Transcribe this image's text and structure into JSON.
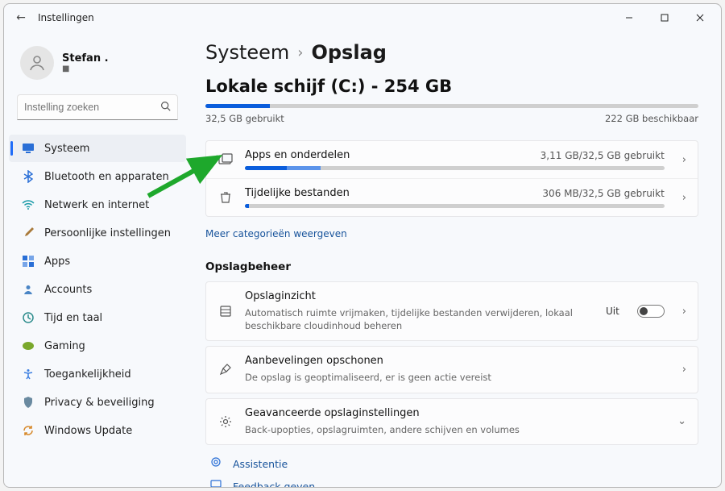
{
  "window": {
    "title": "Instellingen"
  },
  "user": {
    "name": "Stefan .",
    "sub": "■"
  },
  "search": {
    "placeholder": "Instelling zoeken"
  },
  "sidebar": {
    "items": [
      {
        "label": "Systeem",
        "active": true
      },
      {
        "label": "Bluetooth en apparaten"
      },
      {
        "label": "Netwerk en internet"
      },
      {
        "label": "Persoonlijke instellingen"
      },
      {
        "label": "Apps"
      },
      {
        "label": "Accounts"
      },
      {
        "label": "Tijd en taal"
      },
      {
        "label": "Gaming"
      },
      {
        "label": "Toegankelijkheid"
      },
      {
        "label": "Privacy & beveiliging"
      },
      {
        "label": "Windows Update"
      }
    ]
  },
  "breadcrumb": {
    "root": "Systeem",
    "current": "Opslag"
  },
  "drive": {
    "title": "Lokale schijf (C:) - 254 GB",
    "used": "32,5 GB gebruikt",
    "free": "222 GB beschikbaar",
    "used_pct": 13
  },
  "categories": [
    {
      "title": "Apps en onderdelen",
      "right": "3,11 GB/32,5 GB gebruikt",
      "pctA": 10,
      "pctB": 8
    },
    {
      "title": "Tijdelijke bestanden",
      "right": "306 MB/32,5 GB gebruikt",
      "pctA": 1,
      "pctB": 0
    }
  ],
  "more_link": "Meer categorieën weergeven",
  "management": {
    "title": "Opslagbeheer",
    "items": [
      {
        "icon": "sense",
        "title": "Opslaginzicht",
        "sub": "Automatisch ruimte vrijmaken, tijdelijke bestanden verwijderen, lokaal beschikbare cloudinhoud beheren",
        "toggle_label": "Uit",
        "toggle_on": false,
        "chevron": "right"
      },
      {
        "icon": "broom",
        "title": "Aanbevelingen opschonen",
        "sub": "De opslag is geoptimaliseerd, er is geen actie vereist",
        "chevron": "right"
      },
      {
        "icon": "gear",
        "title": "Geavanceerde opslaginstellingen",
        "sub": "Back-upopties, opslagruimten, andere schijven en volumes",
        "chevron": "down"
      }
    ]
  },
  "help": [
    {
      "label": "Assistentie"
    },
    {
      "label": "Feedback geven"
    }
  ]
}
